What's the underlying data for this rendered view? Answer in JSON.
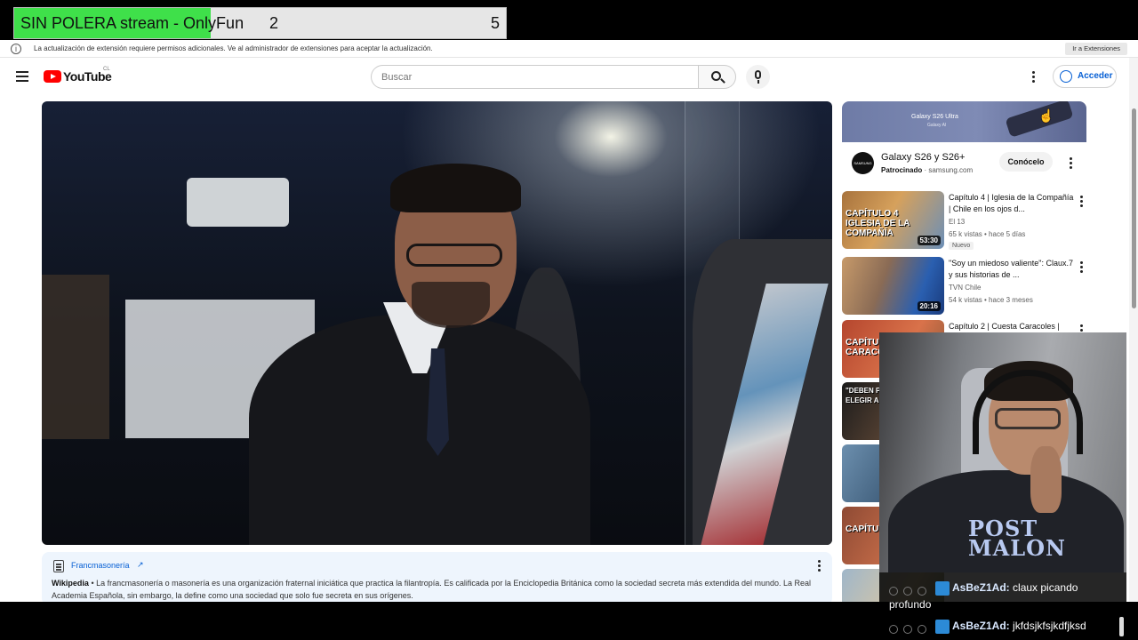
{
  "overlay": {
    "title": "SIN POLERA stream - OnlyFun",
    "current": "2",
    "goal": "5",
    "progress_fraction": 0.4,
    "fill_color": "#3fe04a"
  },
  "notice": {
    "text": "La actualización de extensión requiere permisos adicionales. Ve al administrador de extensiones para aceptar la actualización.",
    "button": "Ir a Extensiones",
    "icon": "info-icon"
  },
  "header": {
    "logo": "YouTube",
    "country": "CL",
    "search_placeholder": "Buscar",
    "signin": "Acceder",
    "brand_color": "#ff0000",
    "link_color": "#065fd4"
  },
  "info_card": {
    "link": "Francmasonería",
    "link_icon": "↗",
    "source": "Wikipedia",
    "separator": " • ",
    "text": "La francmasonería o masonería es una organización fraternal iniciática que practica la filantropía. Es calificada por la Enciclopedia Británica como la sociedad secreta más extendida del mundo. La Real Academia Española, sin embargo, la define como una sociedad que solo fue secreta en sus orígenes."
  },
  "ad": {
    "banner_title": "Galaxy S26 Ultra",
    "banner_sub": "Galaxy AI",
    "avatar_text": "SAMSUNG",
    "title": "Galaxy S26 y S26+",
    "sponsored": "Patrocinado",
    "domain": "samsung.com",
    "dot": " · ",
    "cta": "Conócelo"
  },
  "recommended": [
    {
      "title": "Capítulo 4 | Iglesia de la Compañía | Chile en los ojos d...",
      "channel": "El 13",
      "meta": "65 k vistas • hace 5 días",
      "badge": "Nuevo",
      "duration": "53:30",
      "thumb_text": "CAPÍTULO 4 IGLESIA DE LA COMPAÑÍA"
    },
    {
      "title": "\"Soy un miedoso valiente\": Claux.7 y sus historias de ...",
      "channel": "TVN Chile",
      "meta": "54 k vistas • hace 3 meses",
      "duration": "20:16",
      "thumb_text": ""
    },
    {
      "title": "Capítulo 2 | Cuesta Caracoles |",
      "thumb_text": "CAPÍTU CUESTA CARACO"
    },
    {
      "thumb_text": "\"DEBEN PISA Y ELEGIR A"
    },
    {
      "thumb_text": ""
    },
    {
      "thumb_text": "CAPÍTU TOCOP"
    }
  ],
  "webcam": {
    "shirt_text": "POST MALON"
  },
  "chat": [
    {
      "user": "AsBeZ1Ad:",
      "message": "claux picando profundo"
    },
    {
      "user": "AsBeZ1Ad:",
      "message": "jkfdsjkfsjkdfjksd"
    }
  ]
}
